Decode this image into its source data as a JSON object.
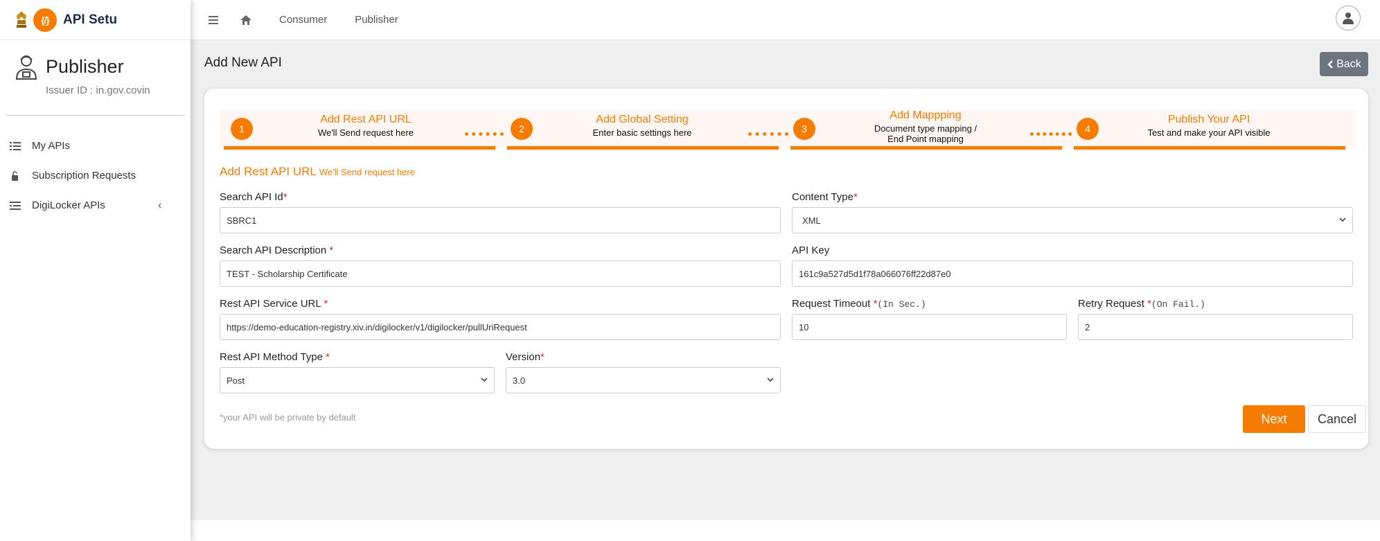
{
  "colors": {
    "accent": "#f57c00",
    "back_button": "#6c757d",
    "required": "#d32f2f"
  },
  "brand": {
    "name": "API Setu",
    "logo_text": "{/}"
  },
  "profile": {
    "title": "Publisher",
    "issuer": "Issuer ID : in.gov.covin"
  },
  "sidebar": {
    "items": [
      {
        "label": "My APIs",
        "icon": "list-icon"
      },
      {
        "label": "Subscription Requests",
        "icon": "lock-icon"
      },
      {
        "label": "DigiLocker APIs",
        "icon": "list-icon"
      }
    ]
  },
  "topbar": {
    "links": [
      "Consumer",
      "Publisher"
    ]
  },
  "page": {
    "title": "Add New API",
    "back_label": "Back"
  },
  "steps": [
    {
      "num": "1",
      "title": "Add Rest API URL",
      "sub": "We'll Send request here"
    },
    {
      "num": "2",
      "title": "Add Global Setting",
      "sub": "Enter basic settings here"
    },
    {
      "num": "3",
      "title": "Add Mappping",
      "sub1": "Document type mapping /",
      "sub2": "End Point mapping"
    },
    {
      "num": "4",
      "title": "Publish Your API",
      "sub": "Test and make your API visible"
    }
  ],
  "section": {
    "title": "Add Rest API URL",
    "subtitle": "We'll Send request here"
  },
  "form": {
    "search_api_id": {
      "label": "Search API Id",
      "req": "*",
      "value": "SBRC1"
    },
    "content_type": {
      "label": "Content Type",
      "req": "*",
      "value": "XML"
    },
    "search_api_desc": {
      "label": "Search API Description ",
      "req": "*",
      "value": "TEST - Scholarship Certificate"
    },
    "api_key": {
      "label": "API Key",
      "value": "161c9a527d5d1f78a066076ff22d87e0"
    },
    "service_url": {
      "label": "Rest API Service URL ",
      "req": "*",
      "value": "https://demo-education-registry.xiv.in/digilocker/v1/digilocker/pullUriRequest"
    },
    "request_timeout": {
      "label": "Request Timeout ",
      "req": "*",
      "hint": "(In Sec.)",
      "value": "10"
    },
    "retry_request": {
      "label": "Retry Request ",
      "req": "*",
      "hint": "(On Fail.)",
      "value": "2"
    },
    "method_type": {
      "label": "Rest API Method Type ",
      "req": "*",
      "value": "Post"
    },
    "version": {
      "label": "Version",
      "req": "*",
      "value": "3.0"
    }
  },
  "footer": {
    "note": "*your API will be private by default",
    "next_label": "Next",
    "cancel_label": "Cancel"
  }
}
